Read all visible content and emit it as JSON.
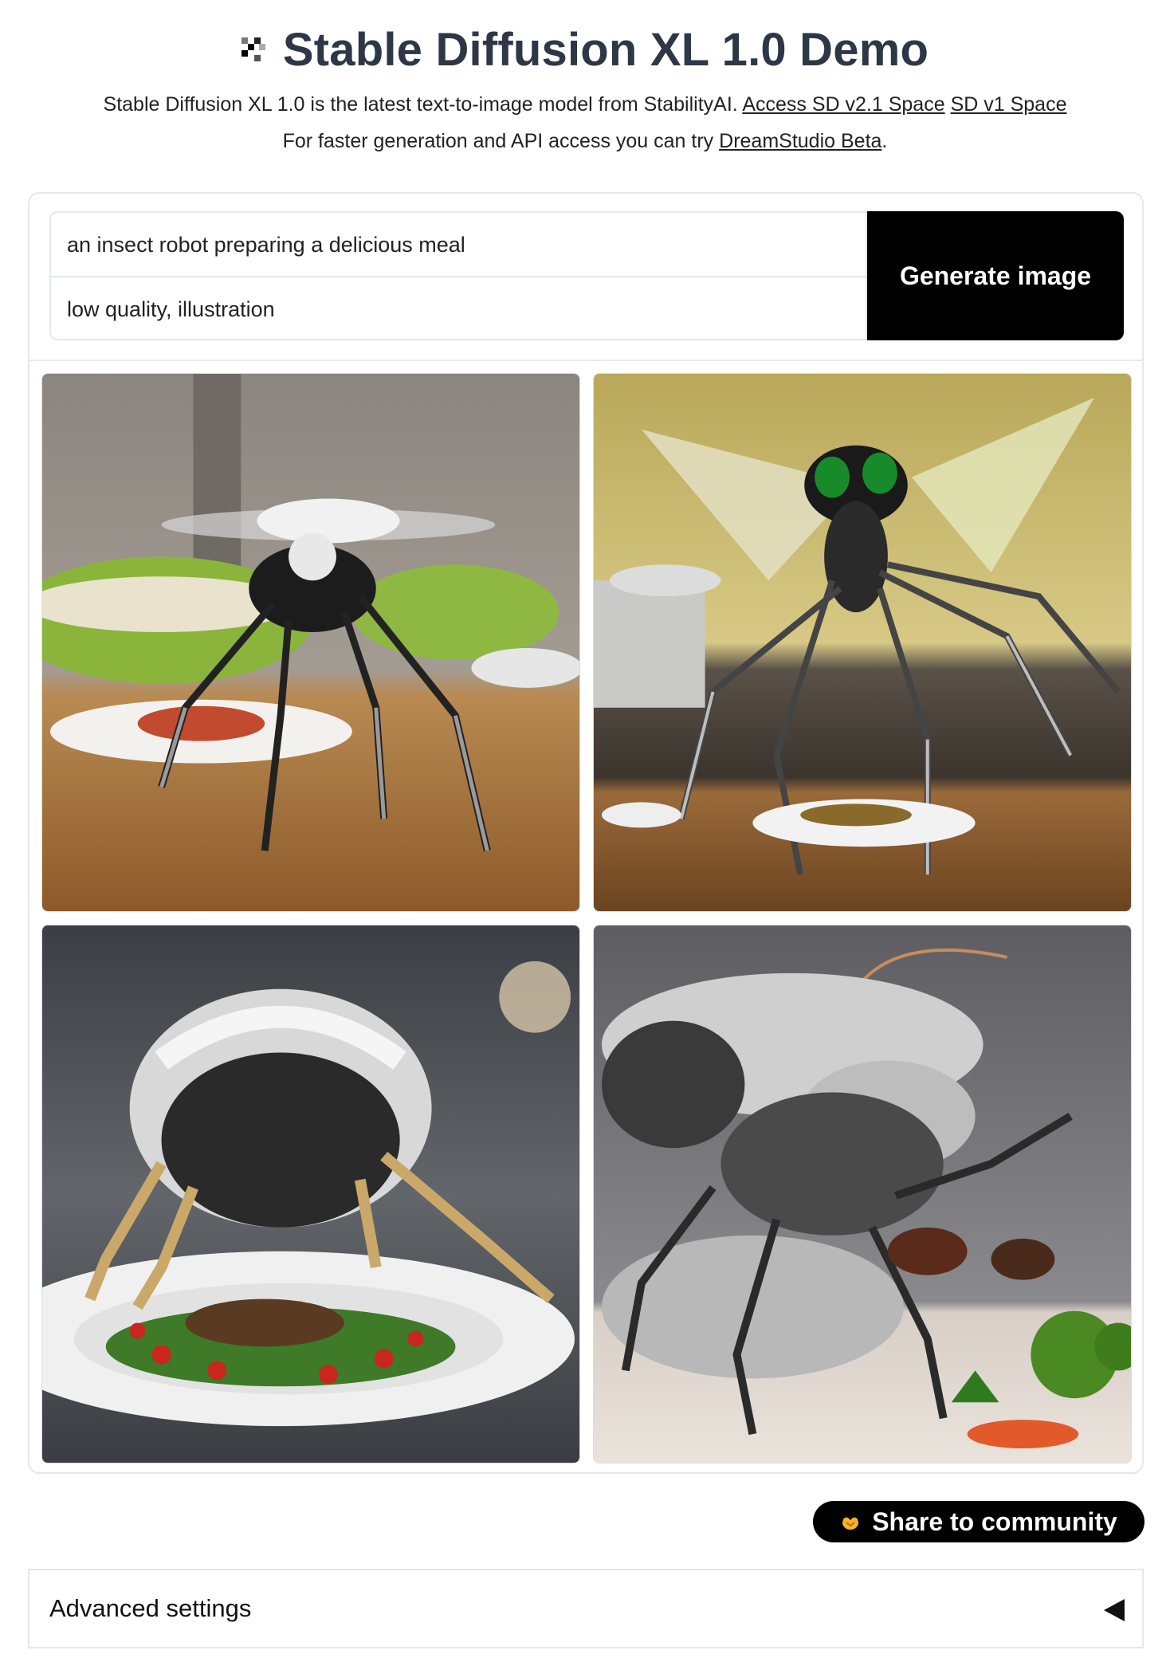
{
  "header": {
    "title": "Stable Diffusion XL 1.0 Demo",
    "subtitle_text": "Stable Diffusion XL 1.0 is the latest text-to-image model from StabilityAI.",
    "link_sd21": "Access SD v2.1 Space",
    "link_sd1": "SD v1 Space",
    "subtitle2_text": "For faster generation and API access you can try",
    "link_dreamstudio": "DreamStudio Beta",
    "subtitle2_end": "."
  },
  "form": {
    "prompt_value": "an insect robot preparing a delicious meal",
    "negative_value": "low quality, illustration",
    "generate_label": "Generate image"
  },
  "gallery": {
    "images": [
      {
        "icon": "robot-fly-salad-image"
      },
      {
        "icon": "robot-wasp-kitchen-image"
      },
      {
        "icon": "robot-beetle-plate-image"
      },
      {
        "icon": "robot-ant-vegetables-image"
      }
    ]
  },
  "share": {
    "label": "Share to community",
    "icon": "hands-icon"
  },
  "advanced": {
    "label": "Advanced settings",
    "icon": "triangle-left-icon"
  },
  "colors": {
    "accent": "#000000",
    "border": "#e5e7eb",
    "title": "#2d3748"
  }
}
